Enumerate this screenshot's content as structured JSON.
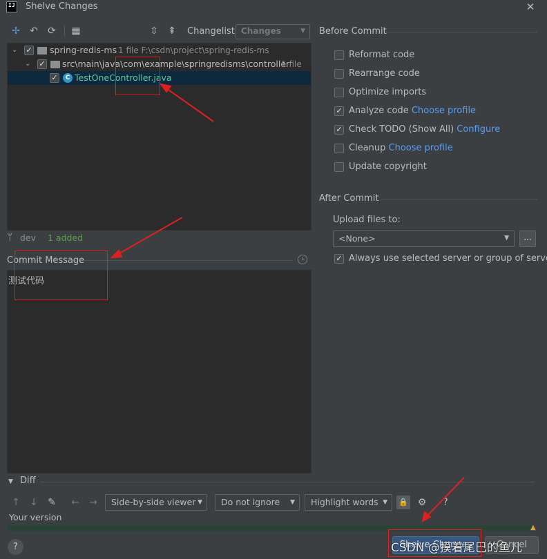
{
  "window": {
    "title": "Shelve Changes",
    "app_icon_text": "IJ"
  },
  "toolbar": {
    "changelist_label": "Changelist:",
    "changelist_value": "Changes",
    "icons": [
      "sync-icon",
      "undo-icon",
      "refresh-icon",
      "group-by-icon",
      "expand-all-icon",
      "collapse-all-icon"
    ]
  },
  "tree": {
    "root": {
      "label": "spring-redis-ms",
      "meta": "1 file  F:\\csdn\\project\\spring-redis-ms"
    },
    "folder": {
      "label": "src\\main\\java\\com\\example\\springredisms\\controller",
      "meta": "1 file"
    },
    "file": {
      "label": "TestOneController.java"
    }
  },
  "branch": {
    "name": "dev",
    "added": "1 added"
  },
  "commit": {
    "label": "Commit Message",
    "message": "测试代码"
  },
  "before_commit": {
    "title": "Before Commit",
    "options": [
      {
        "label": "Reformat code",
        "checked": false,
        "link": ""
      },
      {
        "label": "Rearrange code",
        "checked": false,
        "link": ""
      },
      {
        "label": "Optimize imports",
        "checked": false,
        "link": ""
      },
      {
        "label": "Analyze code",
        "checked": true,
        "link": "Choose profile"
      },
      {
        "label": "Check TODO (Show All)",
        "checked": true,
        "link": "Configure"
      },
      {
        "label": "Cleanup",
        "checked": false,
        "link": "Choose profile"
      },
      {
        "label": "Update copyright",
        "checked": false,
        "link": ""
      }
    ]
  },
  "after_commit": {
    "title": "After Commit",
    "upload_label": "Upload files to:",
    "upload_value": "<None>",
    "more_label": "...",
    "always_use_label": "Always use selected server or group of servers",
    "always_use_checked": true
  },
  "diff": {
    "title": "Diff",
    "viewer": "Side-by-side viewer",
    "ignore": "Do not ignore",
    "highlight": "Highlight words",
    "help_glyph": "?",
    "your_version": "Your version"
  },
  "footer": {
    "help_glyph": "?",
    "shelve_label": "Shelve Changes",
    "cancel_label": "Cancel"
  },
  "watermark": "CSDN @摸着尾巴的鱼儿",
  "colors": {
    "background": "#3c3f41",
    "panel": "#2b2b2b",
    "selection": "#0d293e",
    "file_added": "#62c6a0",
    "link": "#589df6",
    "annotation": "#e02020"
  }
}
